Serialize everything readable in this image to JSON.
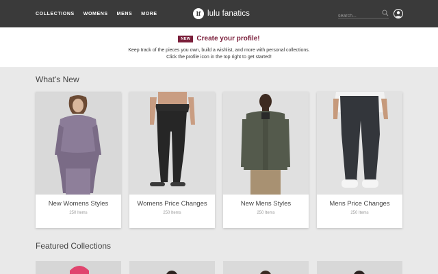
{
  "header": {
    "nav": [
      "COLLECTIONS",
      "WOMENS",
      "MENS",
      "MORE"
    ],
    "logo_text": "lf",
    "brand": "lulu fanatics",
    "search_placeholder": "search..."
  },
  "banner": {
    "badge": "NEW",
    "title": "Create your profile!",
    "text": "Keep track of the pieces you own, build a wishlist, and more with personal collections. Click the profile icon in the top right to get started!"
  },
  "whats_new": {
    "title": "What's New",
    "cards": [
      {
        "title": "New Womens Styles",
        "count": "250 Items"
      },
      {
        "title": "Womens Price Changes",
        "count": "250 Items"
      },
      {
        "title": "New Mens Styles",
        "count": "250 Items"
      },
      {
        "title": "Mens Price Changes",
        "count": "250 Items"
      }
    ]
  },
  "featured": {
    "title": "Featured Collections"
  },
  "colors": {
    "header_bg": "#3a3a3a",
    "accent": "#7a1e3a",
    "page_bg": "#e9e9e9"
  }
}
